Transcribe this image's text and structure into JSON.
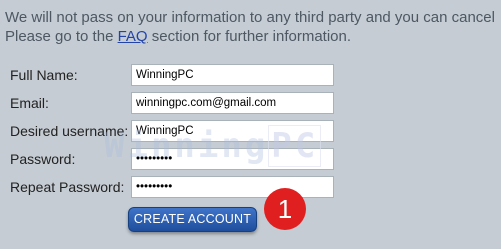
{
  "intro": {
    "line1": "We will not pass on your information to any third party and you can cancel",
    "line2_before": "Please go to the ",
    "faq_link": "FAQ",
    "line2_after": " section for further information."
  },
  "form": {
    "fields": [
      {
        "label": "Full Name:",
        "value": "WinningPC"
      },
      {
        "label": "Email:",
        "value": "winningpc.com@gmail.com"
      },
      {
        "label": "Desired username:",
        "value": "WinningPC"
      },
      {
        "label": "Password:",
        "value": "•••••••••"
      },
      {
        "label": "Repeat Password:",
        "value": "•••••••••"
      }
    ],
    "submit_label": "CREATE ACCOUNT"
  },
  "watermark": {
    "text_main": "Winning",
    "text_pc": "PC"
  },
  "annotation": {
    "step_number": "1",
    "badge_color": "#e02020"
  },
  "colors": {
    "background": "#c5ccd3",
    "button": "#2a5cb0",
    "link": "#2244aa"
  }
}
